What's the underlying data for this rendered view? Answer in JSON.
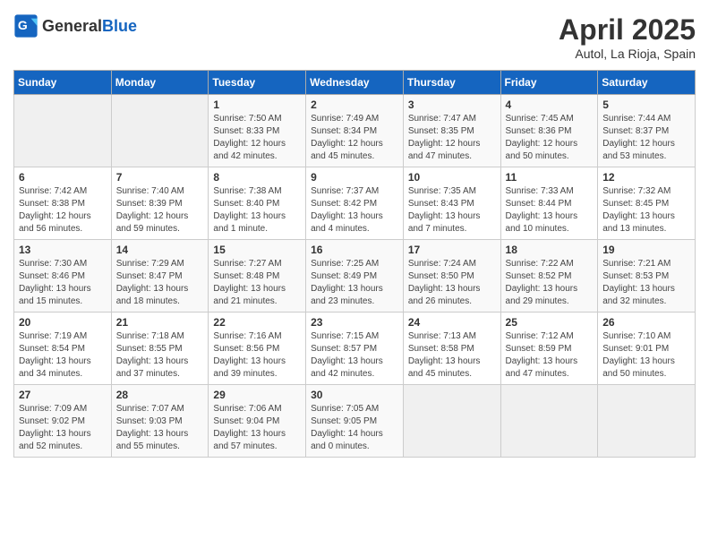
{
  "header": {
    "logo_general": "General",
    "logo_blue": "Blue",
    "title": "April 2025",
    "location": "Autol, La Rioja, Spain"
  },
  "calendar": {
    "days_of_week": [
      "Sunday",
      "Monday",
      "Tuesday",
      "Wednesday",
      "Thursday",
      "Friday",
      "Saturday"
    ],
    "weeks": [
      [
        {
          "day": "",
          "info": ""
        },
        {
          "day": "",
          "info": ""
        },
        {
          "day": "1",
          "info": "Sunrise: 7:50 AM\nSunset: 8:33 PM\nDaylight: 12 hours and 42 minutes."
        },
        {
          "day": "2",
          "info": "Sunrise: 7:49 AM\nSunset: 8:34 PM\nDaylight: 12 hours and 45 minutes."
        },
        {
          "day": "3",
          "info": "Sunrise: 7:47 AM\nSunset: 8:35 PM\nDaylight: 12 hours and 47 minutes."
        },
        {
          "day": "4",
          "info": "Sunrise: 7:45 AM\nSunset: 8:36 PM\nDaylight: 12 hours and 50 minutes."
        },
        {
          "day": "5",
          "info": "Sunrise: 7:44 AM\nSunset: 8:37 PM\nDaylight: 12 hours and 53 minutes."
        }
      ],
      [
        {
          "day": "6",
          "info": "Sunrise: 7:42 AM\nSunset: 8:38 PM\nDaylight: 12 hours and 56 minutes."
        },
        {
          "day": "7",
          "info": "Sunrise: 7:40 AM\nSunset: 8:39 PM\nDaylight: 12 hours and 59 minutes."
        },
        {
          "day": "8",
          "info": "Sunrise: 7:38 AM\nSunset: 8:40 PM\nDaylight: 13 hours and 1 minute."
        },
        {
          "day": "9",
          "info": "Sunrise: 7:37 AM\nSunset: 8:42 PM\nDaylight: 13 hours and 4 minutes."
        },
        {
          "day": "10",
          "info": "Sunrise: 7:35 AM\nSunset: 8:43 PM\nDaylight: 13 hours and 7 minutes."
        },
        {
          "day": "11",
          "info": "Sunrise: 7:33 AM\nSunset: 8:44 PM\nDaylight: 13 hours and 10 minutes."
        },
        {
          "day": "12",
          "info": "Sunrise: 7:32 AM\nSunset: 8:45 PM\nDaylight: 13 hours and 13 minutes."
        }
      ],
      [
        {
          "day": "13",
          "info": "Sunrise: 7:30 AM\nSunset: 8:46 PM\nDaylight: 13 hours and 15 minutes."
        },
        {
          "day": "14",
          "info": "Sunrise: 7:29 AM\nSunset: 8:47 PM\nDaylight: 13 hours and 18 minutes."
        },
        {
          "day": "15",
          "info": "Sunrise: 7:27 AM\nSunset: 8:48 PM\nDaylight: 13 hours and 21 minutes."
        },
        {
          "day": "16",
          "info": "Sunrise: 7:25 AM\nSunset: 8:49 PM\nDaylight: 13 hours and 23 minutes."
        },
        {
          "day": "17",
          "info": "Sunrise: 7:24 AM\nSunset: 8:50 PM\nDaylight: 13 hours and 26 minutes."
        },
        {
          "day": "18",
          "info": "Sunrise: 7:22 AM\nSunset: 8:52 PM\nDaylight: 13 hours and 29 minutes."
        },
        {
          "day": "19",
          "info": "Sunrise: 7:21 AM\nSunset: 8:53 PM\nDaylight: 13 hours and 32 minutes."
        }
      ],
      [
        {
          "day": "20",
          "info": "Sunrise: 7:19 AM\nSunset: 8:54 PM\nDaylight: 13 hours and 34 minutes."
        },
        {
          "day": "21",
          "info": "Sunrise: 7:18 AM\nSunset: 8:55 PM\nDaylight: 13 hours and 37 minutes."
        },
        {
          "day": "22",
          "info": "Sunrise: 7:16 AM\nSunset: 8:56 PM\nDaylight: 13 hours and 39 minutes."
        },
        {
          "day": "23",
          "info": "Sunrise: 7:15 AM\nSunset: 8:57 PM\nDaylight: 13 hours and 42 minutes."
        },
        {
          "day": "24",
          "info": "Sunrise: 7:13 AM\nSunset: 8:58 PM\nDaylight: 13 hours and 45 minutes."
        },
        {
          "day": "25",
          "info": "Sunrise: 7:12 AM\nSunset: 8:59 PM\nDaylight: 13 hours and 47 minutes."
        },
        {
          "day": "26",
          "info": "Sunrise: 7:10 AM\nSunset: 9:01 PM\nDaylight: 13 hours and 50 minutes."
        }
      ],
      [
        {
          "day": "27",
          "info": "Sunrise: 7:09 AM\nSunset: 9:02 PM\nDaylight: 13 hours and 52 minutes."
        },
        {
          "day": "28",
          "info": "Sunrise: 7:07 AM\nSunset: 9:03 PM\nDaylight: 13 hours and 55 minutes."
        },
        {
          "day": "29",
          "info": "Sunrise: 7:06 AM\nSunset: 9:04 PM\nDaylight: 13 hours and 57 minutes."
        },
        {
          "day": "30",
          "info": "Sunrise: 7:05 AM\nSunset: 9:05 PM\nDaylight: 14 hours and 0 minutes."
        },
        {
          "day": "",
          "info": ""
        },
        {
          "day": "",
          "info": ""
        },
        {
          "day": "",
          "info": ""
        }
      ]
    ]
  }
}
